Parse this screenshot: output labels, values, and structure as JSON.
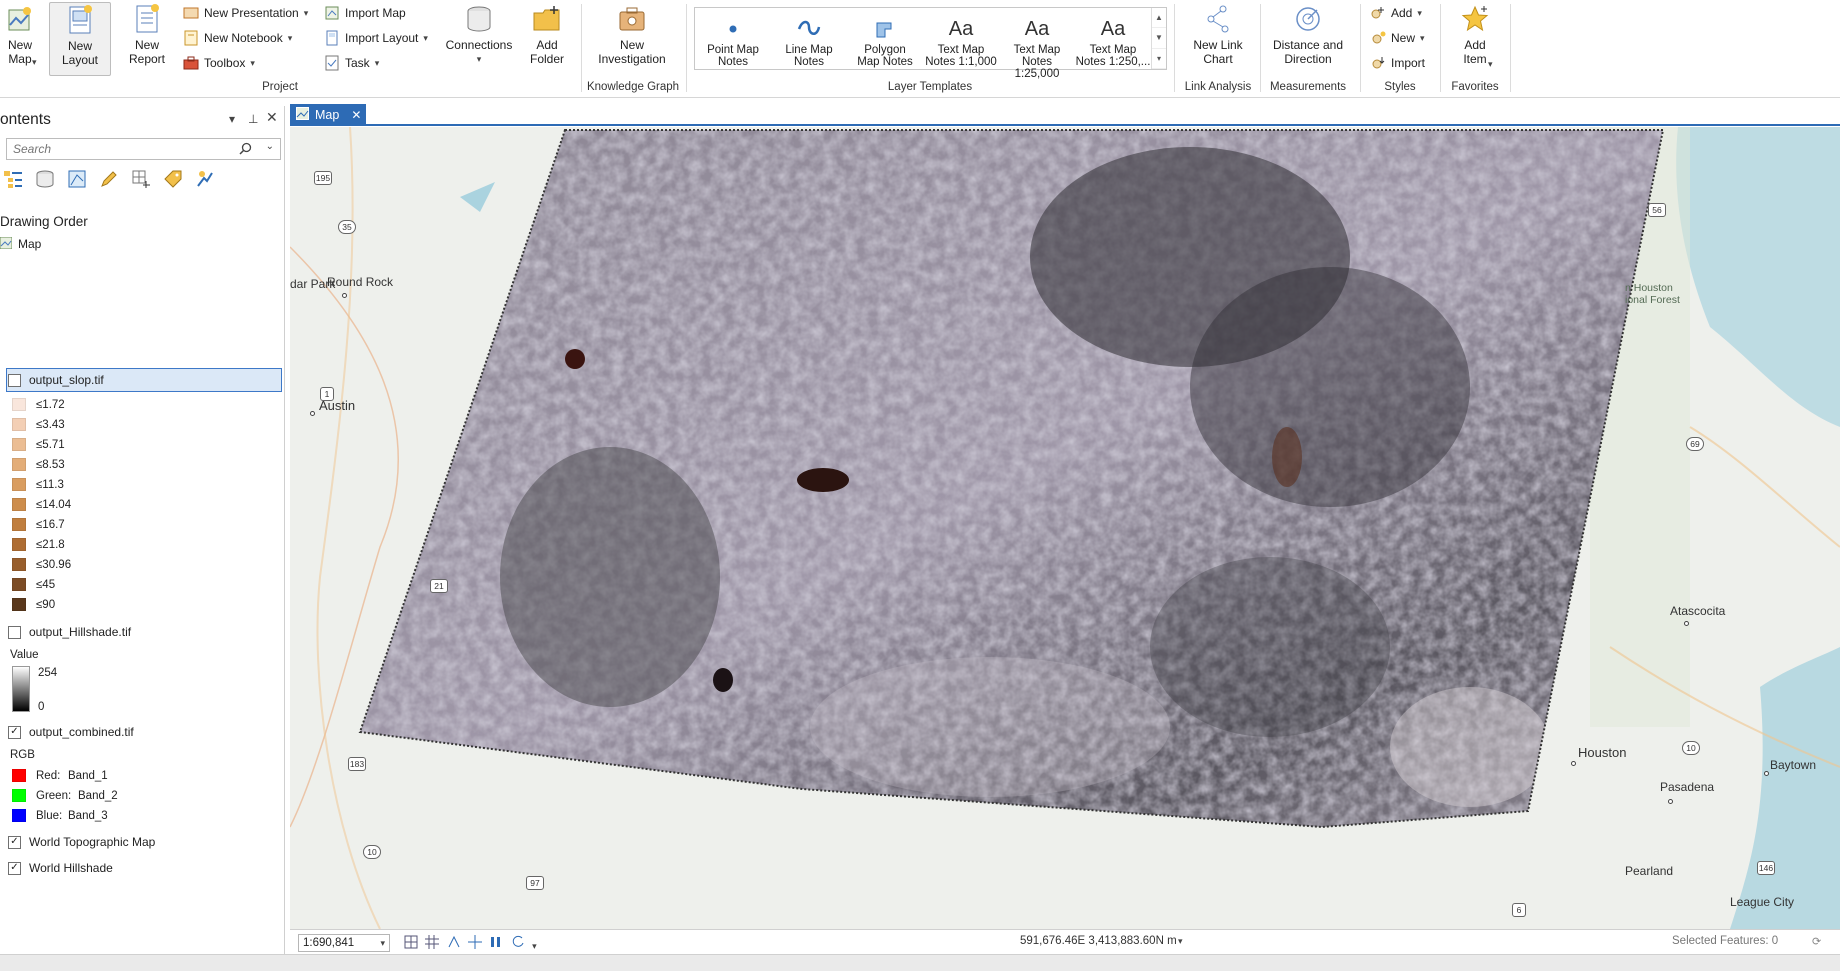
{
  "ribbon": {
    "project": {
      "group_label": "Project",
      "new_map": "New\nMap",
      "new_layout": "New\nLayout",
      "new_report": "New\nReport",
      "new_presentation": "New Presentation",
      "new_notebook": "New Notebook",
      "toolbox": "Toolbox",
      "import_map": "Import Map",
      "import_layout": "Import Layout",
      "task": "Task",
      "connections": "Connections",
      "add_folder": "Add\nFolder"
    },
    "knowledge_graph": {
      "group_label": "Knowledge Graph",
      "new_investigation": "New\nInvestigation"
    },
    "layer_templates": {
      "group_label": "Layer Templates",
      "items": [
        {
          "label": "Point Map\nNotes",
          "icon": "point-notes-icon"
        },
        {
          "label": "Line Map\nNotes",
          "icon": "line-notes-icon"
        },
        {
          "label": "Polygon\nMap Notes",
          "icon": "polygon-notes-icon"
        },
        {
          "label": "Text Map\nNotes 1:1,000",
          "icon": "text-notes-icon"
        },
        {
          "label": "Text Map\nNotes 1:25,000",
          "icon": "text-notes-icon"
        },
        {
          "label": "Text Map\nNotes 1:250,...",
          "icon": "text-notes-icon"
        }
      ],
      "glyph": "Aa"
    },
    "link_analysis": {
      "group_label": "Link Analysis",
      "new_link_chart": "New Link\nChart"
    },
    "measurements": {
      "group_label": "Measurements",
      "distance_direction": "Distance and\nDirection"
    },
    "styles": {
      "group_label": "Styles",
      "add": "Add",
      "new": "New",
      "import": "Import"
    },
    "favorites": {
      "group_label": "Favorites",
      "add_item": "Add\nItem"
    }
  },
  "contents": {
    "title": "ontents",
    "search_placeholder": "Search",
    "drawing_order": "Drawing Order",
    "map_node": "Map",
    "layers": {
      "slope": {
        "name": "output_slop.tif",
        "checked": false,
        "classes": [
          {
            "label": "≤1.72",
            "color": "#f9e6dc"
          },
          {
            "label": "≤3.43",
            "color": "#f3cfb5"
          },
          {
            "label": "≤5.71",
            "color": "#ebbd93"
          },
          {
            "label": "≤8.53",
            "color": "#e3ad78"
          },
          {
            "label": "≤11.3",
            "color": "#d99d60"
          },
          {
            "label": "≤14.04",
            "color": "#cd8d4c"
          },
          {
            "label": "≤16.7",
            "color": "#c07e3e"
          },
          {
            "label": "≤21.8",
            "color": "#ae6d33"
          },
          {
            "label": "≤30.96",
            "color": "#985e2c"
          },
          {
            "label": "≤45",
            "color": "#7c4c25"
          },
          {
            "label": "≤90",
            "color": "#5a381c"
          }
        ]
      },
      "hillshade": {
        "name": "output_Hillshade.tif",
        "checked": false,
        "value_label": "Value",
        "max": "254",
        "min": "0"
      },
      "combined": {
        "name": "output_combined.tif",
        "checked": true,
        "rgb_label": "RGB",
        "bands": [
          {
            "label": "Red:",
            "band": "Band_1",
            "color": "#ff0000"
          },
          {
            "label": "Green:",
            "band": "Band_2",
            "color": "#00ff00"
          },
          {
            "label": "Blue:",
            "band": "Band_3",
            "color": "#0000ff"
          }
        ]
      },
      "topo": {
        "name": "World Topographic Map",
        "checked": true
      },
      "world_hillshade": {
        "name": "World Hillshade",
        "checked": true
      }
    },
    "check_mark": "✓"
  },
  "map": {
    "tab_label": "Map",
    "places": {
      "round_rock": "Round Rock",
      "dar_park": "dar Park",
      "austin": "Austin",
      "houston": "Houston",
      "pasadena": "Pasadena",
      "baytown": "Baytown",
      "pearland": "Pearland",
      "league_city": "League City",
      "atascocita": "Atascocita",
      "forest_1": "n Houston",
      "forest_2": "ional Forest"
    },
    "shields": [
      "195",
      "35",
      "1",
      "21",
      "183",
      "10",
      "97",
      "56",
      "69",
      "10",
      "146",
      "6"
    ]
  },
  "status": {
    "scale": "1:690,841",
    "coordinates": "591,676.46E 3,413,883.60N m",
    "selected_features": "Selected Features: 0"
  }
}
